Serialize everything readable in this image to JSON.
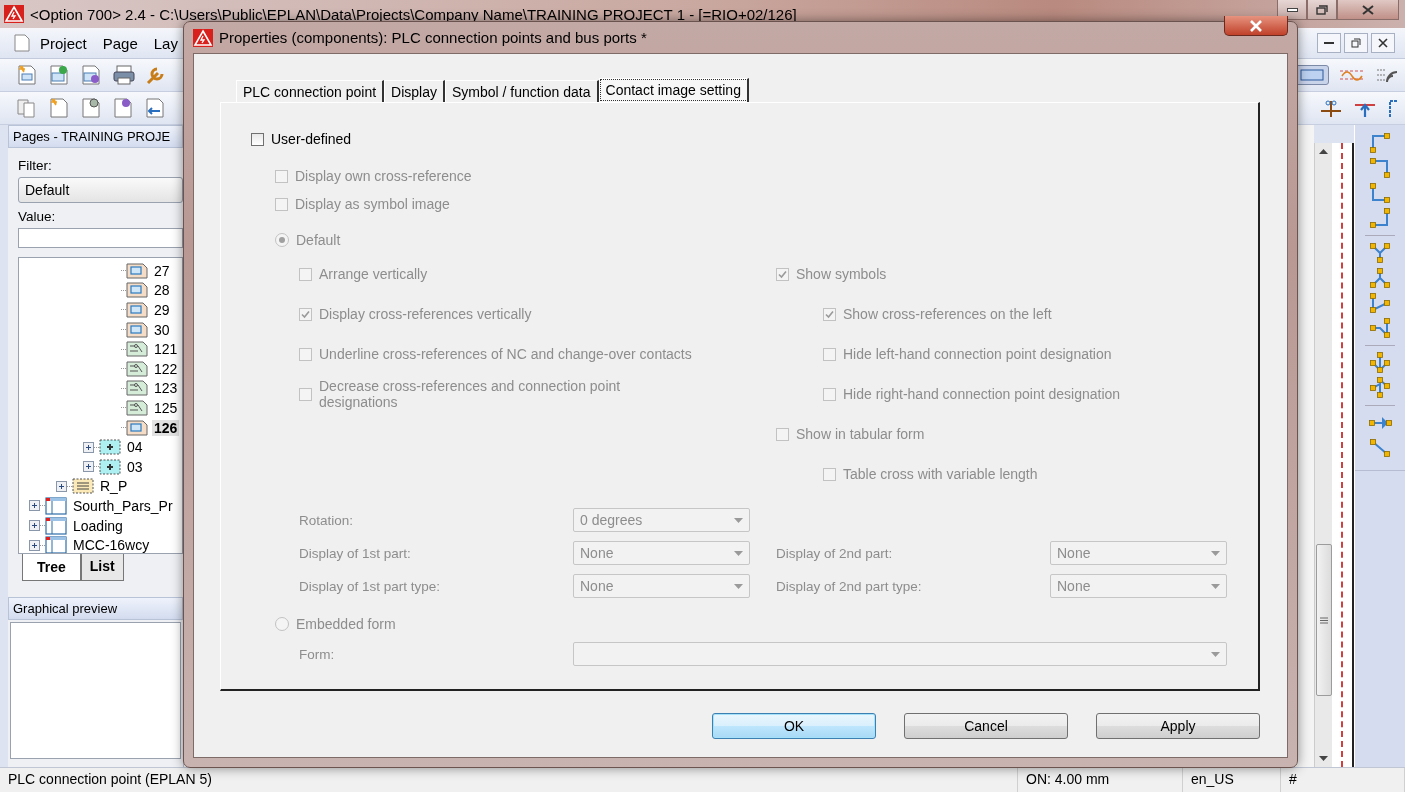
{
  "main_window": {
    "title": "<Option 700> 2.4 - C:\\Users\\Public\\EPLAN\\Data\\Projects\\Company Name\\TRAINING PROJECT 1 - [=RIO+02/126]",
    "menu": [
      "Project",
      "Page",
      "Lay"
    ]
  },
  "pages_panel": {
    "title": "Pages - TRAINING PROJE",
    "filter_label": "Filter:",
    "filter_value": "Default",
    "value_label": "Value:",
    "tree": [
      {
        "children": [
          {
            "children": [
              {
                "children": [
                  {
                    "label": "27",
                    "kind": "page",
                    "selected": false
                  },
                  {
                    "label": "28",
                    "kind": "page",
                    "selected": false
                  },
                  {
                    "label": "29",
                    "kind": "page",
                    "selected": false
                  },
                  {
                    "label": "30",
                    "kind": "page",
                    "selected": false
                  },
                  {
                    "label": "121",
                    "kind": "schematic",
                    "selected": false
                  },
                  {
                    "label": "122",
                    "kind": "schematic",
                    "selected": false
                  },
                  {
                    "label": "123",
                    "kind": "schematic",
                    "selected": false
                  },
                  {
                    "label": "125",
                    "kind": "schematic",
                    "selected": false
                  },
                  {
                    "label": "126",
                    "kind": "page",
                    "selected": true
                  }
                ]
              },
              {
                "label": "04",
                "kind": "location",
                "expanded": false,
                "selected": false
              },
              {
                "label": "03",
                "kind": "location",
                "expanded": false,
                "selected": false
              }
            ]
          },
          {
            "label": "R_P",
            "kind": "structure",
            "expanded": false,
            "selected": false
          }
        ]
      },
      {
        "label": "Sourth_Pars_Pr",
        "kind": "project",
        "expanded": false,
        "selected": false
      },
      {
        "label": "Loading",
        "kind": "project",
        "expanded": false,
        "selected": false
      },
      {
        "label": "MCC-16wcy",
        "kind": "project",
        "expanded": false,
        "selected": false
      }
    ],
    "tabs": [
      {
        "label": "Tree",
        "selected": true
      },
      {
        "label": "List",
        "selected": false
      }
    ]
  },
  "preview_panel": {
    "title": "Graphical preview"
  },
  "status_bar": [
    "PLC connection point (EPLAN 5)",
    "ON: 4.00 mm",
    "en_US",
    "#"
  ],
  "dialog": {
    "title": "Properties (components): PLC connection points and bus ports *",
    "tabs": [
      {
        "label": "PLC connection point",
        "selected": false
      },
      {
        "label": "Display",
        "selected": false
      },
      {
        "label": "Symbol / function data",
        "selected": false
      },
      {
        "label": "Contact image setting",
        "selected": true
      }
    ],
    "user_defined": {
      "label": "User-defined",
      "checked": false
    },
    "settings": {
      "disabled": true,
      "own_options": [
        {
          "label": "Display own cross-reference",
          "checked": false
        },
        {
          "label": "Display as symbol image",
          "checked": false
        }
      ],
      "default_radio": {
        "label": "Default",
        "selected": true
      },
      "left_options": [
        {
          "label": "Arrange vertically",
          "checked": false
        },
        {
          "label": "Display cross-references vertically",
          "checked": true
        },
        {
          "label": "Underline cross-references of NC and change-over contacts",
          "checked": false
        },
        {
          "label": "Decrease cross-references and connection point designations",
          "checked": false
        }
      ],
      "right_options": [
        {
          "label": "Show symbols",
          "checked": true,
          "children": [
            {
              "label": "Show cross-references on the left",
              "checked": true
            },
            {
              "label": "Hide left-hand connection point designation",
              "checked": false
            },
            {
              "label": "Hide right-hand connection point designation",
              "checked": false
            }
          ]
        },
        {
          "label": "Show in tabular form",
          "checked": false,
          "children": [
            {
              "label": "Table cross with variable length",
              "checked": false
            }
          ]
        }
      ],
      "field_rows": [
        {
          "cells": [
            {
              "label": "Rotation:",
              "value": "0 degrees"
            }
          ]
        },
        {
          "cells": [
            {
              "label": "Display of 1st part:",
              "value": "None"
            },
            {
              "label": "Display of 2nd part:",
              "value": "None"
            }
          ]
        },
        {
          "cells": [
            {
              "label": "Display of 1st part type:",
              "value": "None"
            },
            {
              "label": "Display of 2nd part type:",
              "value": "None"
            }
          ]
        }
      ],
      "embedded_radio": {
        "label": "Embedded form",
        "selected": false
      },
      "form_field": {
        "label": "Form:"
      }
    },
    "buttons": [
      {
        "label": "OK",
        "default": true
      },
      {
        "label": "Cancel",
        "default": false
      },
      {
        "label": "Apply",
        "default": false
      }
    ]
  }
}
